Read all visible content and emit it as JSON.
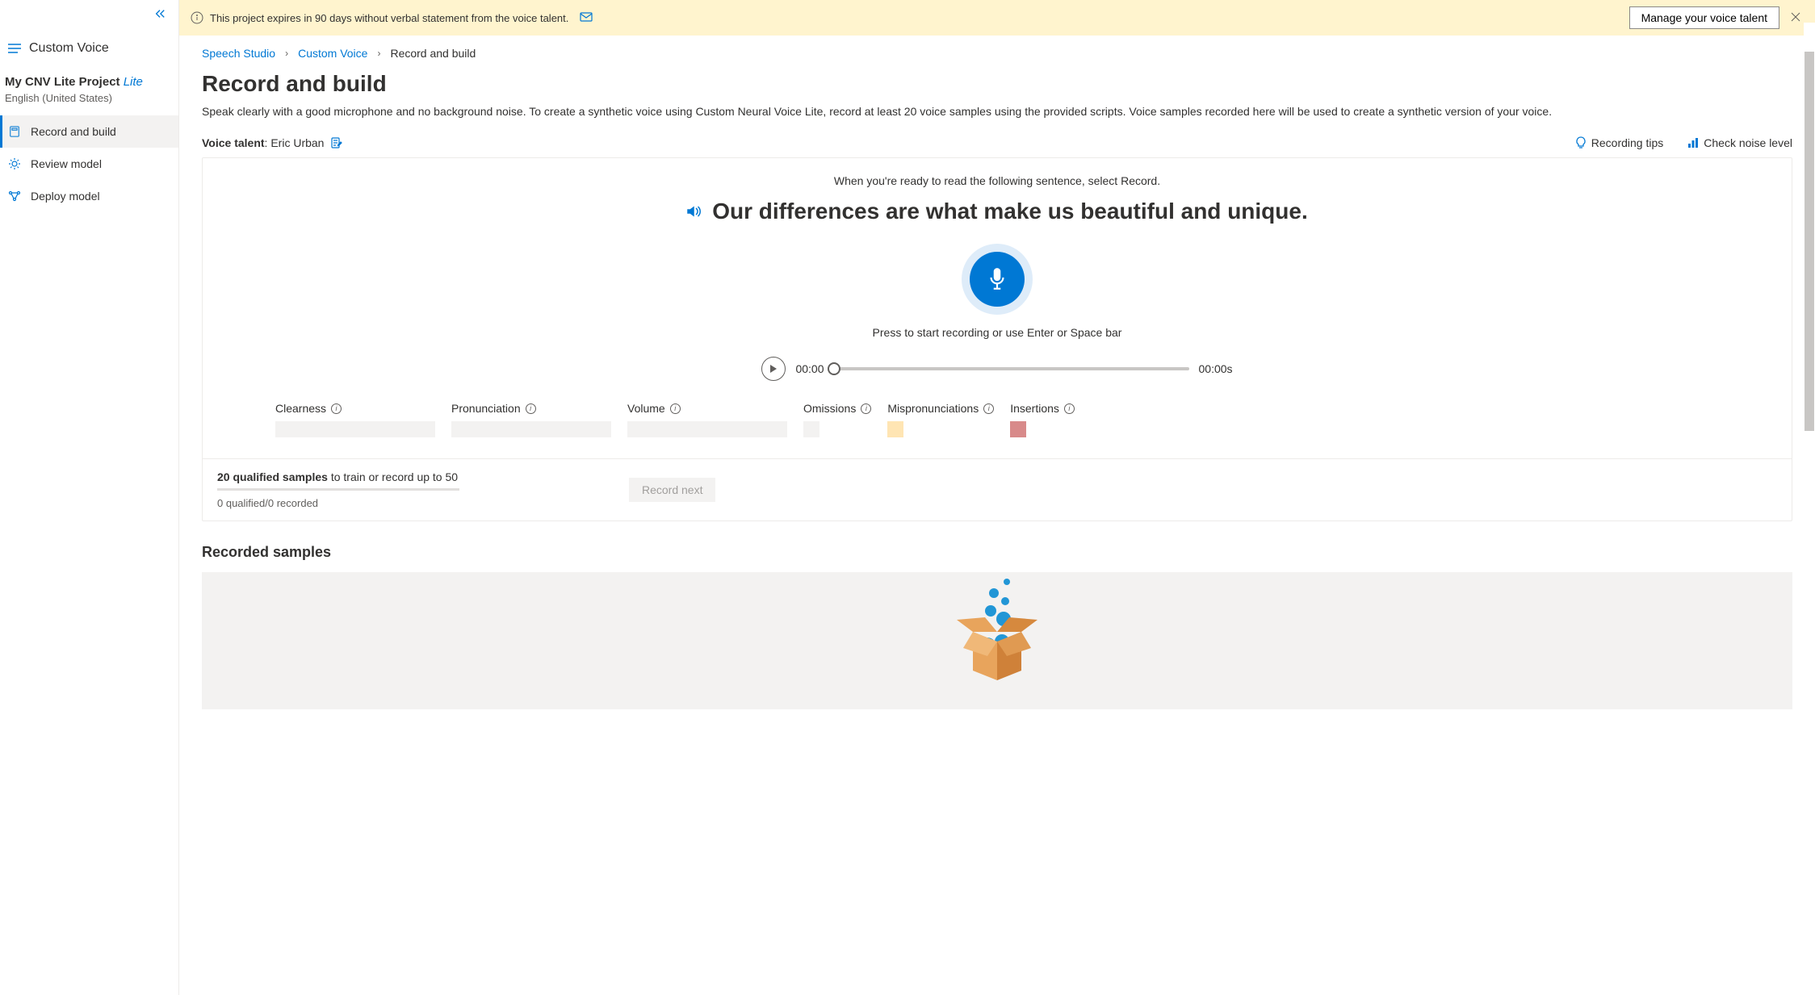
{
  "sidebar": {
    "app_title": "Custom Voice",
    "project_name": "My CNV Lite Project",
    "project_badge": "Lite",
    "project_language": "English (United States)",
    "items": [
      {
        "label": "Record and build",
        "icon": "record-icon",
        "active": true
      },
      {
        "label": "Review model",
        "icon": "review-icon",
        "active": false
      },
      {
        "label": "Deploy model",
        "icon": "deploy-icon",
        "active": false
      }
    ]
  },
  "notification": {
    "text": "This project expires in 90 days without verbal statement from the voice talent.",
    "button": "Manage your voice talent"
  },
  "breadcrumb": {
    "items": [
      "Speech Studio",
      "Custom Voice",
      "Record and build"
    ]
  },
  "page": {
    "title": "Record and build",
    "description": "Speak clearly with a good microphone and no background noise. To create a synthetic voice using Custom Neural Voice Lite, record at least 20 voice samples using the provided scripts. Voice samples recorded here will be used to create a synthetic version of your voice."
  },
  "voice_talent": {
    "label": "Voice talent",
    "name": "Eric Urban"
  },
  "tips": {
    "recording_tips": "Recording tips",
    "noise_level": "Check noise level"
  },
  "recording": {
    "instruction": "When you're ready to read the following sentence, select Record.",
    "sentence": "Our differences are what make us beautiful and unique.",
    "hint": "Press to start recording or use Enter or Space bar",
    "time_current": "00:00",
    "time_total": "00:00s"
  },
  "metrics": {
    "clearness": "Clearness",
    "pronunciation": "Pronunciation",
    "volume": "Volume",
    "omissions": "Omissions",
    "mispronunciations": "Mispronunciations",
    "insertions": "Insertions"
  },
  "progress": {
    "prefix": "20 qualified samples",
    "suffix": " to train or record up to 50",
    "status": "0 qualified/0 recorded",
    "record_next": "Record next"
  },
  "samples": {
    "title": "Recorded samples"
  }
}
